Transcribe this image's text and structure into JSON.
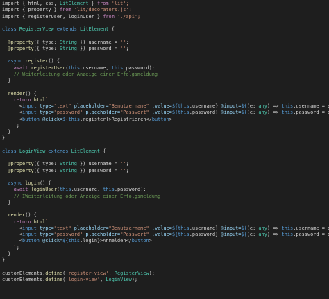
{
  "code_lines": [
    [
      [
        "import { html, css, ",
        "plain"
      ],
      [
        "LitElement",
        "cls"
      ],
      [
        " } ",
        "plain"
      ],
      [
        "from",
        "kw2"
      ],
      [
        " 'lit';",
        "str"
      ]
    ],
    [
      [
        "import { property } ",
        "plain"
      ],
      [
        "from",
        "kw2"
      ],
      [
        " 'lit/decorators.js';",
        "str"
      ]
    ],
    [
      [
        "import { registerUser, loginUser } ",
        "plain"
      ],
      [
        "from",
        "kw2"
      ],
      [
        " './api';",
        "str"
      ]
    ],
    [],
    [
      [
        "class ",
        "kw"
      ],
      [
        "RegisterView",
        "cls"
      ],
      [
        " extends ",
        "kw"
      ],
      [
        "LitElement",
        "cls"
      ],
      [
        " {",
        "plain"
      ]
    ],
    [],
    [
      [
        "  @property",
        "dec"
      ],
      [
        "({ type: ",
        "plain"
      ],
      [
        "String",
        "type"
      ],
      [
        " }) username = ",
        "plain"
      ],
      [
        "''",
        "str"
      ],
      [
        ";",
        "plain"
      ]
    ],
    [
      [
        "  @property",
        "dec"
      ],
      [
        "({ type: ",
        "plain"
      ],
      [
        "String",
        "type"
      ],
      [
        " }) password = ",
        "plain"
      ],
      [
        "''",
        "str"
      ],
      [
        ";",
        "plain"
      ]
    ],
    [],
    [
      [
        "  async ",
        "kw"
      ],
      [
        "register",
        "fn"
      ],
      [
        "() {",
        "plain"
      ]
    ],
    [
      [
        "    await ",
        "kw2"
      ],
      [
        "registerUser",
        "fn"
      ],
      [
        "(",
        "plain"
      ],
      [
        "this",
        "this"
      ],
      [
        ".username, ",
        "plain"
      ],
      [
        "this",
        "this"
      ],
      [
        ".password);",
        "plain"
      ]
    ],
    [
      [
        "    // Weiterleitung oder Anzeige einer Erfolgsmeldung",
        "com"
      ]
    ],
    [
      [
        "  }",
        "plain"
      ]
    ],
    [],
    [
      [
        "  render",
        "fn"
      ],
      [
        "() {",
        "plain"
      ]
    ],
    [
      [
        "    return ",
        "kw2"
      ],
      [
        "html",
        "fn"
      ],
      [
        "`",
        "str"
      ]
    ],
    [
      [
        "      <",
        "punc"
      ],
      [
        "input",
        "tag"
      ],
      [
        " type=",
        "attr"
      ],
      [
        "\"text\"",
        "str"
      ],
      [
        " placeholder=",
        "attr"
      ],
      [
        "\"Benutzername\"",
        "str"
      ],
      [
        " .value=",
        "attr"
      ],
      [
        "${",
        "kw"
      ],
      [
        "this",
        "this"
      ],
      [
        ".username}",
        "plain"
      ],
      [
        " @input=",
        "attr"
      ],
      [
        "${",
        "kw"
      ],
      [
        "(e: ",
        "plain"
      ],
      [
        "any",
        "type"
      ],
      [
        ") => ",
        "plain"
      ],
      [
        "this",
        "this"
      ],
      [
        ".username = e.target.value}",
        "plain"
      ],
      [
        ">",
        "punc"
      ]
    ],
    [
      [
        "      <",
        "punc"
      ],
      [
        "input",
        "tag"
      ],
      [
        " type=",
        "attr"
      ],
      [
        "\"password\"",
        "str"
      ],
      [
        " placeholder=",
        "attr"
      ],
      [
        "\"Passwort\"",
        "str"
      ],
      [
        " .value=",
        "attr"
      ],
      [
        "${",
        "kw"
      ],
      [
        "this",
        "this"
      ],
      [
        ".password}",
        "plain"
      ],
      [
        " @input=",
        "attr"
      ],
      [
        "${",
        "kw"
      ],
      [
        "(e: ",
        "plain"
      ],
      [
        "any",
        "type"
      ],
      [
        ") => ",
        "plain"
      ],
      [
        "this",
        "this"
      ],
      [
        ".password = e.target.value}",
        "plain"
      ],
      [
        ">",
        "punc"
      ]
    ],
    [
      [
        "      <",
        "punc"
      ],
      [
        "button",
        "tag"
      ],
      [
        " @click=",
        "attr"
      ],
      [
        "${",
        "kw"
      ],
      [
        "this",
        "this"
      ],
      [
        ".register}",
        "plain"
      ],
      [
        ">Registrieren</",
        "plain"
      ],
      [
        "button",
        "tag"
      ],
      [
        ">",
        "punc"
      ]
    ],
    [
      [
        "    `",
        "str"
      ],
      [
        ";",
        "plain"
      ]
    ],
    [
      [
        "  }",
        "plain"
      ]
    ],
    [
      [
        "}",
        "plain"
      ]
    ],
    [],
    [
      [
        "class ",
        "kw"
      ],
      [
        "LoginView",
        "cls"
      ],
      [
        " extends ",
        "kw"
      ],
      [
        "LitElement",
        "cls"
      ],
      [
        " {",
        "plain"
      ]
    ],
    [],
    [
      [
        "  @property",
        "dec"
      ],
      [
        "({ type: ",
        "plain"
      ],
      [
        "String",
        "type"
      ],
      [
        " }) username = ",
        "plain"
      ],
      [
        "''",
        "str"
      ],
      [
        ";",
        "plain"
      ]
    ],
    [
      [
        "  @property",
        "dec"
      ],
      [
        "({ type: ",
        "plain"
      ],
      [
        "String",
        "type"
      ],
      [
        " }) password = ",
        "plain"
      ],
      [
        "''",
        "str"
      ],
      [
        ";",
        "plain"
      ]
    ],
    [],
    [
      [
        "  async ",
        "kw"
      ],
      [
        "login",
        "fn"
      ],
      [
        "() {",
        "plain"
      ]
    ],
    [
      [
        "    await ",
        "kw2"
      ],
      [
        "loginUser",
        "fn"
      ],
      [
        "(",
        "plain"
      ],
      [
        "this",
        "this"
      ],
      [
        ".username, ",
        "plain"
      ],
      [
        "this",
        "this"
      ],
      [
        ".password);",
        "plain"
      ]
    ],
    [
      [
        "    // IWeiterleitung oder Anzeige einer Erfolgsmeldung",
        "com"
      ]
    ],
    [
      [
        "  }",
        "plain"
      ]
    ],
    [],
    [
      [
        "  render",
        "fn"
      ],
      [
        "() {",
        "plain"
      ]
    ],
    [
      [
        "    return ",
        "kw2"
      ],
      [
        "html",
        "fn"
      ],
      [
        "`",
        "str"
      ]
    ],
    [
      [
        "      <",
        "punc"
      ],
      [
        "input",
        "tag"
      ],
      [
        " type=",
        "attr"
      ],
      [
        "\"text\"",
        "str"
      ],
      [
        " placeholder=",
        "attr"
      ],
      [
        "\"Benutzername\"",
        "str"
      ],
      [
        " .value=",
        "attr"
      ],
      [
        "${",
        "kw"
      ],
      [
        "this",
        "this"
      ],
      [
        ".username}",
        "plain"
      ],
      [
        " @input=",
        "attr"
      ],
      [
        "${",
        "kw"
      ],
      [
        "(e: ",
        "plain"
      ],
      [
        "any",
        "type"
      ],
      [
        ") => ",
        "plain"
      ],
      [
        "this",
        "this"
      ],
      [
        ".username = e.target.value}",
        "plain"
      ],
      [
        ">",
        "punc"
      ]
    ],
    [
      [
        "      <",
        "punc"
      ],
      [
        "input",
        "tag"
      ],
      [
        " type=",
        "attr"
      ],
      [
        "\"password\"",
        "str"
      ],
      [
        " placeholder=",
        "attr"
      ],
      [
        "\"Passwort\"",
        "str"
      ],
      [
        " .value=",
        "attr"
      ],
      [
        "${",
        "kw"
      ],
      [
        "this",
        "this"
      ],
      [
        ".password}",
        "plain"
      ],
      [
        " @input=",
        "attr"
      ],
      [
        "${",
        "kw"
      ],
      [
        "(e: ",
        "plain"
      ],
      [
        "any",
        "type"
      ],
      [
        ") => ",
        "plain"
      ],
      [
        "this",
        "this"
      ],
      [
        ".password = e.target.value}",
        "plain"
      ],
      [
        ">",
        "punc"
      ]
    ],
    [
      [
        "      <",
        "punc"
      ],
      [
        "button",
        "tag"
      ],
      [
        " @click=",
        "attr"
      ],
      [
        "${",
        "kw"
      ],
      [
        "this",
        "this"
      ],
      [
        ".login}",
        "plain"
      ],
      [
        ">Anmelden</",
        "plain"
      ],
      [
        "button",
        "tag"
      ],
      [
        ">",
        "punc"
      ]
    ],
    [
      [
        "    `",
        "str"
      ],
      [
        ";",
        "plain"
      ]
    ],
    [
      [
        "  }",
        "plain"
      ]
    ],
    [
      [
        "}",
        "plain"
      ]
    ],
    [],
    [
      [
        "customElements.",
        "plain"
      ],
      [
        "define",
        "fn"
      ],
      [
        "(",
        "plain"
      ],
      [
        "'register-view'",
        "str"
      ],
      [
        ", ",
        "plain"
      ],
      [
        "RegisterView",
        "cls"
      ],
      [
        ");",
        "plain"
      ]
    ],
    [
      [
        "customElements.",
        "plain"
      ],
      [
        "define",
        "fn"
      ],
      [
        "(",
        "plain"
      ],
      [
        "'login-view'",
        "str"
      ],
      [
        ", ",
        "plain"
      ],
      [
        "LoginView",
        "cls"
      ],
      [
        ");",
        "plain"
      ]
    ]
  ],
  "colors": {
    "background": "#1e1e1e",
    "plain": "#d4d4d4",
    "keyword": "#569cd6",
    "control": "#c586c0",
    "class": "#4ec9b0",
    "string": "#ce9178",
    "function": "#dcdcaa",
    "comment": "#6a9955",
    "attribute": "#9cdcfe"
  }
}
